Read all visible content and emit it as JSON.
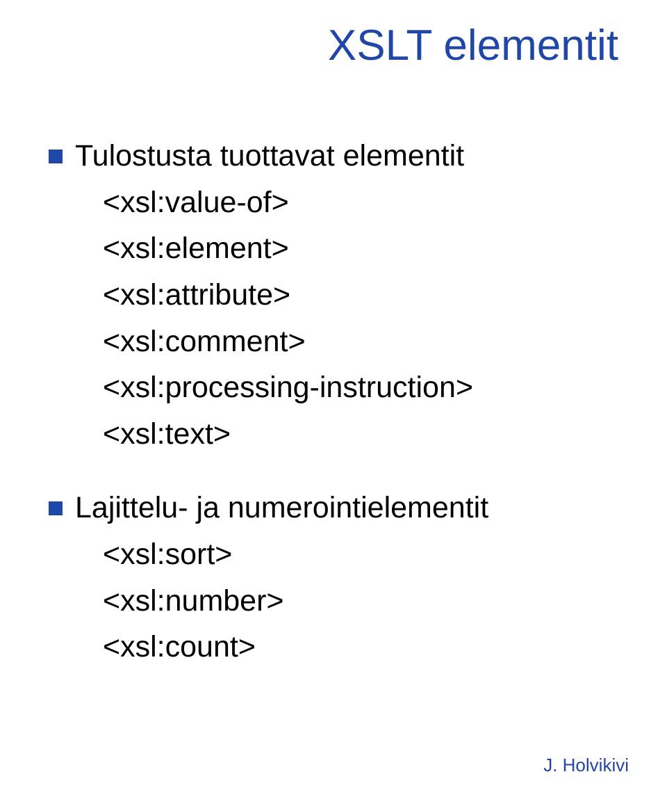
{
  "slide": {
    "title": "XSLT elementit",
    "groups": [
      {
        "heading": "Tulostusta tuottavat elementit",
        "items": [
          "<xsl:value-of>",
          "<xsl:element>",
          "<xsl:attribute>",
          "<xsl:comment>",
          "<xsl:processing-instruction>",
          "<xsl:text>"
        ]
      },
      {
        "heading": "Lajittelu- ja numerointielementit",
        "items": [
          "<xsl:sort>",
          "<xsl:number>",
          "<xsl:count>"
        ]
      }
    ],
    "footer": "J. Holvikivi"
  }
}
